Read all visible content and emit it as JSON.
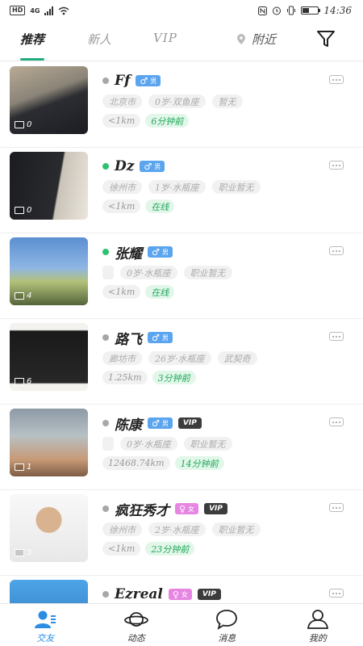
{
  "status_bar": {
    "left": [
      "HD",
      "4G"
    ],
    "time": "14:36"
  },
  "tabs": [
    {
      "label": "推荐",
      "active": true
    },
    {
      "label": "新人",
      "active": false
    },
    {
      "label": "VIP",
      "active": false
    },
    {
      "label": "附近",
      "active": false
    }
  ],
  "users": [
    {
      "name": "Ff",
      "online": false,
      "gender_symbol": "♂",
      "gender_label": "男",
      "gender_color": "#5ba5ef",
      "vip": false,
      "tags": [
        "北京市",
        "0岁·双鱼座",
        "暂无"
      ],
      "distance": "<1km",
      "active": "6分钟前",
      "photo_count": "0"
    },
    {
      "name": "Dz",
      "online": true,
      "gender_symbol": "♂",
      "gender_label": "男",
      "gender_color": "#5ba5ef",
      "vip": false,
      "tags": [
        "徐州市",
        "1岁·水瓶座",
        "职业暂无"
      ],
      "distance": "<1km",
      "active": "在线",
      "photo_count": "0"
    },
    {
      "name": "张耀",
      "online": true,
      "gender_symbol": "♂",
      "gender_label": "男",
      "gender_color": "#5ba5ef",
      "vip": false,
      "tags": [
        "",
        "0岁·水瓶座",
        "职业暂无"
      ],
      "distance": "<1km",
      "active": "在线",
      "photo_count": "4"
    },
    {
      "name": "路飞",
      "online": false,
      "gender_symbol": "♂",
      "gender_label": "男",
      "gender_color": "#5ba5ef",
      "vip": false,
      "tags": [
        "廊坊市",
        "26岁·水瓶座",
        "武契奇"
      ],
      "distance": "1.25km",
      "active": "3分钟前",
      "photo_count": "6"
    },
    {
      "name": "陈康",
      "online": false,
      "gender_symbol": "♂",
      "gender_label": "男",
      "gender_color": "#5ba5ef",
      "vip": true,
      "vip_label": "VIP",
      "tags": [
        "",
        "0岁·水瓶座",
        "职业暂无"
      ],
      "distance": "12468.74km",
      "active": "14分钟前",
      "photo_count": "1"
    },
    {
      "name": "疯狂秀才",
      "online": false,
      "gender_symbol": "♀",
      "gender_label": "女",
      "gender_color": "#e786e2",
      "vip": true,
      "vip_label": "VIP",
      "tags": [
        "徐州市",
        "2岁·水瓶座",
        "职业暂无"
      ],
      "distance": "<1km",
      "active": "23分钟前",
      "photo_count": "3"
    },
    {
      "name": "Ezreal",
      "online": false,
      "gender_symbol": "♀",
      "gender_label": "女",
      "gender_color": "#e786e2",
      "vip": true,
      "vip_label": "VIP",
      "tags": [],
      "distance": "",
      "active": "",
      "photo_count": ""
    }
  ],
  "bottom_nav": [
    {
      "label": "交友",
      "icon": "friends-icon",
      "active": true
    },
    {
      "label": "动态",
      "icon": "planet-icon",
      "active": false
    },
    {
      "label": "消息",
      "icon": "message-icon",
      "active": false
    },
    {
      "label": "我的",
      "icon": "profile-icon",
      "active": false
    }
  ]
}
